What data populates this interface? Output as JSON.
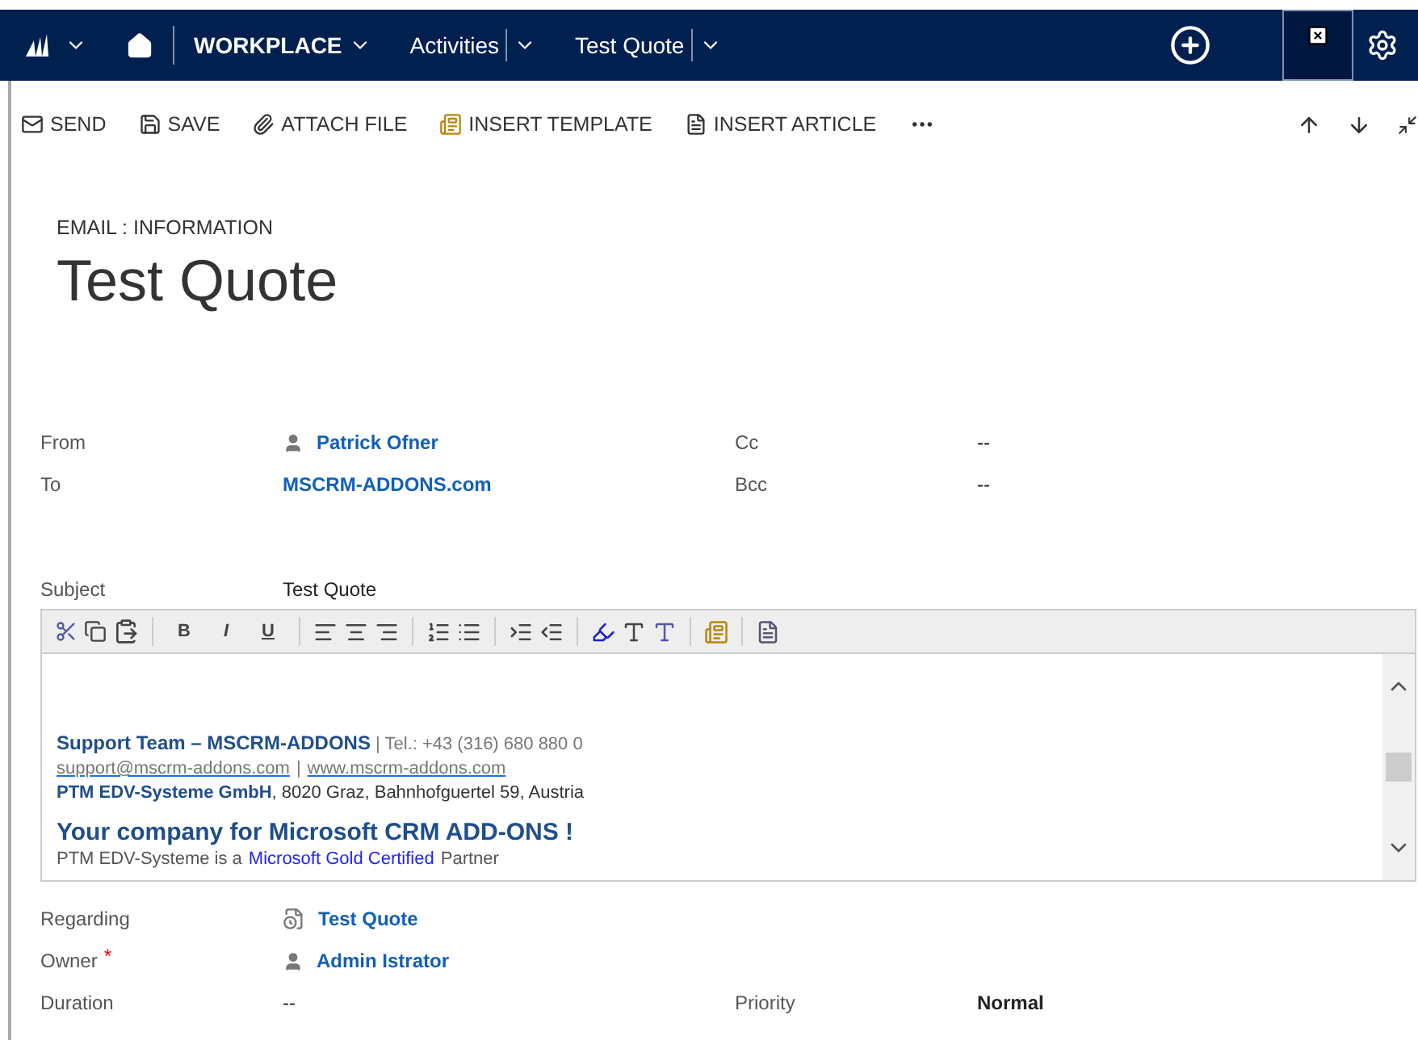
{
  "nav": {
    "area": "WORKPLACE",
    "items": [
      {
        "label": "Activities"
      },
      {
        "label": "Test Quote"
      }
    ]
  },
  "commands": [
    {
      "kind": "send",
      "label": "SEND"
    },
    {
      "kind": "save",
      "label": "SAVE"
    },
    {
      "kind": "attach",
      "label": "ATTACH FILE"
    },
    {
      "kind": "template",
      "label": "INSERT TEMPLATE"
    },
    {
      "kind": "article",
      "label": "INSERT ARTICLE"
    }
  ],
  "header": {
    "entity": "EMAIL : INFORMATION",
    "title": "Test Quote"
  },
  "fields_top": [
    {
      "label": "From",
      "value": "Patrick Ofner",
      "kind": "user",
      "label2": "Cc",
      "value2": "--"
    },
    {
      "label": "To",
      "value": "MSCRM-ADDONS.com",
      "kind": "link",
      "label2": "Bcc",
      "value2": "--"
    }
  ],
  "subject": {
    "label": "Subject",
    "value": "Test Quote"
  },
  "editor": {
    "format_buttons": [
      "B",
      "I",
      "U"
    ],
    "signature": {
      "line1": "**Support Team – MSCRM-ADDONS** | Tel.: +43 (316) 680 880 0",
      "email": "support@mscrm-addons.com",
      "separator": "|",
      "website": "www.mscrm-addons.com",
      "address": "**PTM EDV-Systeme GmbH**, 8020 Graz, Bahnhofguertel 59, Austria",
      "slogan": "Your company for Microsoft CRM ADD-ONS !",
      "partner_before": "PTM EDV-Systeme is a",
      "partner_link": "Microsoft Gold Certified",
      "partner_after": "Partner"
    }
  },
  "fields_bottom": [
    {
      "label": "Regarding",
      "value": "Test Quote",
      "kind": "record"
    },
    {
      "label": "Owner",
      "value": "Admin Istrator",
      "kind": "user",
      "required_mark": "*"
    },
    {
      "label": "Duration",
      "value": "--",
      "kind": "plain",
      "label2": "Priority",
      "value2": "Normal"
    }
  ]
}
